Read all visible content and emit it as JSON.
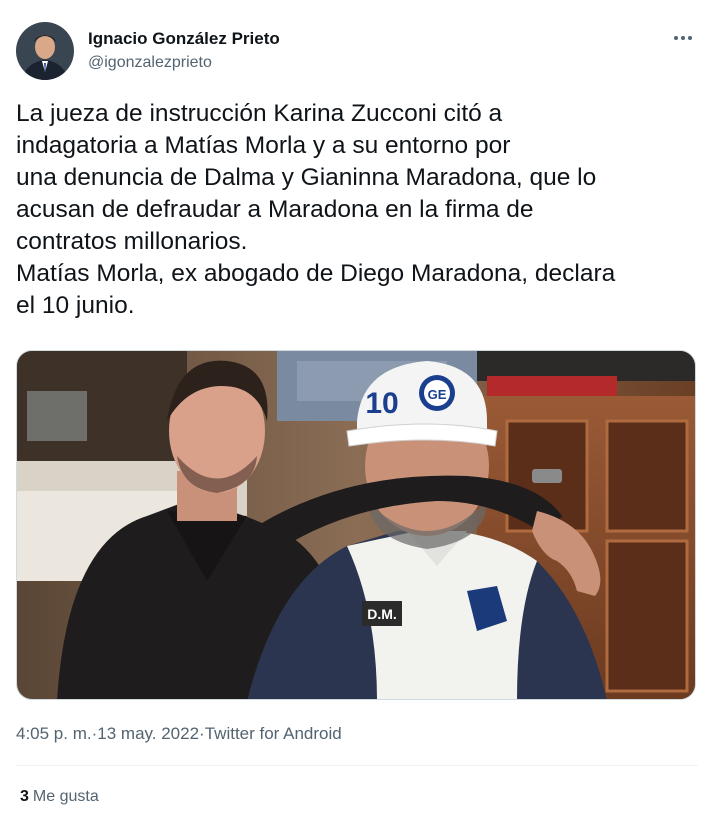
{
  "author": {
    "display_name": "Ignacio González Prieto",
    "handle": "@igonzalezprieto",
    "avatar_icon": "avatar-photo"
  },
  "tweet": {
    "text": "La jueza de instrucción Karina Zucconi citó a\nindagatoria a Matías Morla y a su entorno por\nuna denuncia de Dalma y Gianinna Maradona, que lo\nacusan de defraudar a Maradona en la firma de\ncontratos millonarios.\nMatías Morla, ex abogado de Diego Maradona, declara\nel 10 junio.",
    "photo_cap_text": "10",
    "photo_cap_badge": "GE",
    "photo_shirt_text": "D.M."
  },
  "meta": {
    "time": "4:05 p. m.",
    "separator_1": " · ",
    "date": "13 may. 2022",
    "separator_2": " · ",
    "source": "Twitter for Android"
  },
  "stats": {
    "likes_count": "3",
    "likes_label": "Me gusta"
  },
  "colors": {
    "text_primary": "#0f1419",
    "text_secondary": "#536471",
    "divider": "#eff3f4"
  }
}
